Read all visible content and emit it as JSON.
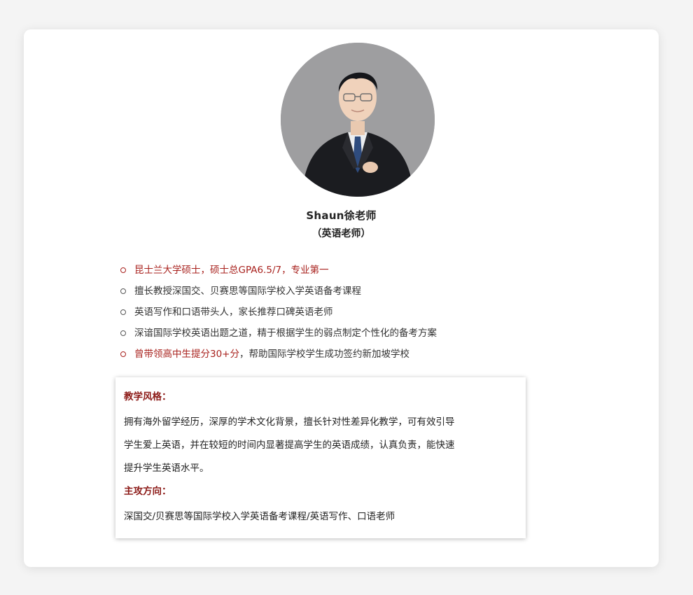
{
  "profile": {
    "name": "Shaun徐老师",
    "role": "（英语老师）"
  },
  "highlights": [
    {
      "red": "昆士兰大学硕士，硕士总GPA6.5/7，专业第一",
      "rest": ""
    },
    {
      "red": "",
      "rest": "擅长教授深国交、贝赛思等国际学校入学英语备考课程"
    },
    {
      "red": "",
      "rest": "英语写作和口语带头人，家长推荐口碑英语老师"
    },
    {
      "red": "",
      "rest": "深谙国际学校英语出题之道，精于根据学生的弱点制定个性化的备考方案"
    },
    {
      "red": "曾带领高中生提分30+分",
      "rest": "，帮助国际学校学生成功签约新加坡学校"
    }
  ],
  "details": {
    "style_title": "教学风格：",
    "style_lines": [
      "拥有海外留学经历，深厚的学术文化背景，擅长针对性差异化教学，可有效引导",
      "学生爱上英语，并在较短的时间内显著提高学生的英语成绩，认真负责，能快速",
      "提升学生英语水平。"
    ],
    "direction_title": "主攻方向：",
    "direction_text": "深国交/贝赛思等国际学校入学英语备考课程/英语写作、口语老师"
  },
  "colors": {
    "accent_red": "#a8211d",
    "heading_red": "#8c1a17",
    "avatar_bg": "#9e9ea0"
  }
}
